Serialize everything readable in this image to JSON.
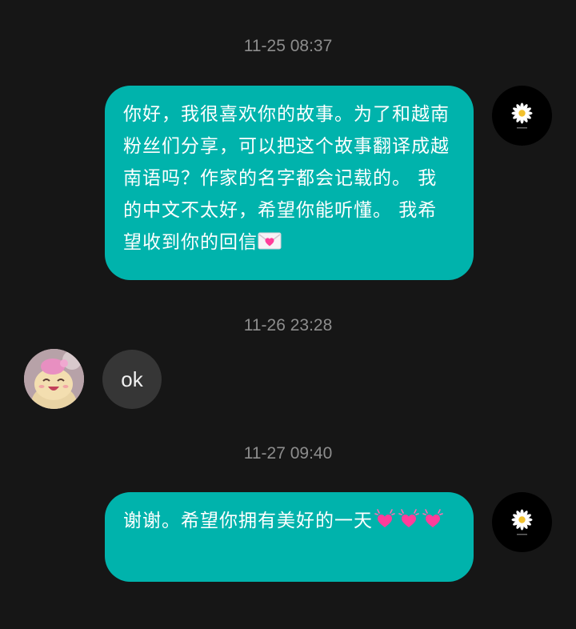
{
  "messages": [
    {
      "timestamp": "11-25 08:37",
      "sender": "me",
      "text": "你好，我很喜欢你的故事。为了和越南粉丝们分享，可以把这个故事翻译成越南语吗？作家的名字都会记载的。 我的中文不太好，希望你能听懂。 我希望收到你的回信",
      "trailing_emoji": "love-letter-icon"
    },
    {
      "timestamp": "11-26 23:28",
      "sender": "other",
      "text": "ok"
    },
    {
      "timestamp": "11-27 09:40",
      "sender": "me",
      "text": "谢谢。希望你拥有美好的一天",
      "trailing_emoji": "beating-heart-icon ×3"
    }
  ],
  "colors": {
    "background": "#161616",
    "outgoing_bubble": "#00b3ac",
    "incoming_bubble": "#363636",
    "timestamp": "#8d8d8d",
    "heart": "#ff3d9a"
  }
}
